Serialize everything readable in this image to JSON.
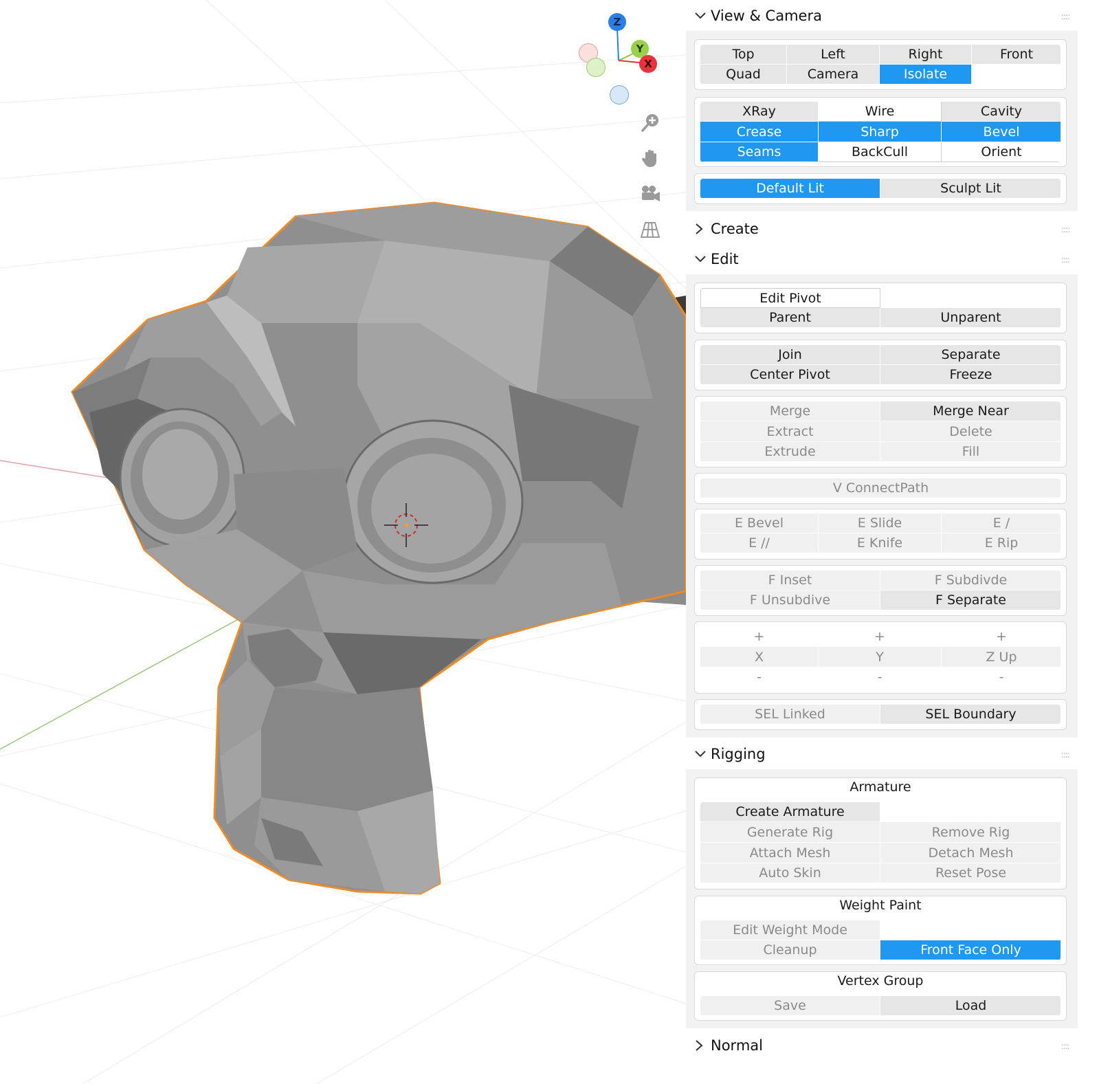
{
  "gizmo": {
    "z": "Z",
    "y": "Y",
    "x": "X"
  },
  "nav_icons": [
    "zoom-in-icon",
    "hand-pan-icon",
    "camera-icon",
    "grid-perspective-icon"
  ],
  "colors": {
    "accent": "#1f98f2",
    "selection_outline": "#f08a24",
    "axis_x": "#e8333d",
    "axis_y": "#8cc63f",
    "axis_z": "#2a7fe6"
  },
  "sections": {
    "view_camera": {
      "title": "View & Camera",
      "views": [
        "Top",
        "Left",
        "Right",
        "Front",
        "Quad",
        "Camera",
        "Isolate"
      ],
      "overlays": [
        "XRay",
        "Wire",
        "Cavity",
        "Crease",
        "Sharp",
        "Bevel",
        "Seams",
        "BackCull",
        "Orient"
      ],
      "lighting": [
        "Default Lit",
        "Sculpt Lit"
      ]
    },
    "create": {
      "title": "Create"
    },
    "edit": {
      "title": "Edit",
      "pivot": [
        "Edit Pivot",
        "Parent",
        "Unparent"
      ],
      "object": [
        "Join",
        "Separate",
        "Center Pivot",
        "Freeze"
      ],
      "merge": [
        "Merge",
        "Merge Near",
        "Extract",
        "Delete",
        "Extrude",
        "Fill"
      ],
      "connect": [
        "V ConnectPath"
      ],
      "edges": [
        "E Bevel",
        "E Slide",
        "E /",
        "E //",
        "E Knife",
        "E Rip"
      ],
      "faces": [
        "F Inset",
        "F Subdivde",
        "F Unsubdive",
        "F Separate"
      ],
      "axis": [
        "+",
        "+",
        "+",
        "X",
        "Y",
        "Z Up",
        "-",
        "-",
        "-"
      ],
      "select": [
        "SEL Linked",
        "SEL Boundary"
      ]
    },
    "rigging": {
      "title": "Rigging",
      "armature": {
        "title": "Armature",
        "buttons": [
          "Create Armature",
          "Generate Rig",
          "Remove Rig",
          "Attach Mesh",
          "Detach Mesh",
          "Auto Skin",
          "Reset Pose"
        ]
      },
      "weight_paint": {
        "title": "Weight Paint",
        "buttons": [
          "Edit Weight Mode",
          "Cleanup",
          "Front Face Only"
        ]
      },
      "vertex_group": {
        "title": "Vertex Group",
        "buttons": [
          "Save",
          "Load"
        ]
      }
    },
    "normal": {
      "title": "Normal"
    }
  }
}
